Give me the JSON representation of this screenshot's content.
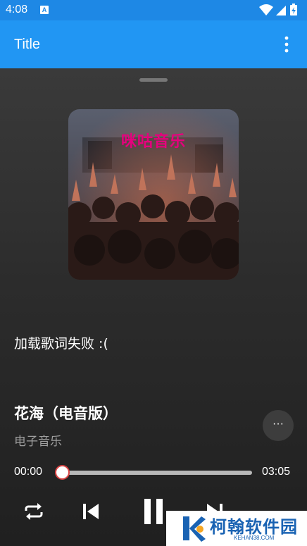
{
  "status_bar": {
    "time": "4:08",
    "notification_badge": "A",
    "icons": [
      "wifi-icon",
      "signal-icon",
      "battery-icon"
    ]
  },
  "app_bar": {
    "title": "Title",
    "menu_icon": "more-vert-icon"
  },
  "player": {
    "album_art_brand": "咪咕音乐",
    "lyrics_status": "加载歌词失败 :(",
    "song_title": "花海（电音版）",
    "artist": "电子音乐",
    "more_label": "···",
    "current_time": "00:00",
    "total_time": "03:05",
    "progress": 0.0,
    "state": "playing",
    "controls": [
      "repeat-icon",
      "skip-previous-icon",
      "pause-icon",
      "skip-next-icon"
    ]
  },
  "watermark": {
    "text": "柯翰软件园",
    "url": "KEHAN38.COM"
  },
  "colors": {
    "app_bar": "#2196f3",
    "status_bar": "#1e88e5",
    "background": "#2a2a2a",
    "progress_track": "#b8b8b8",
    "watermark_blue": "#1a63b3"
  }
}
